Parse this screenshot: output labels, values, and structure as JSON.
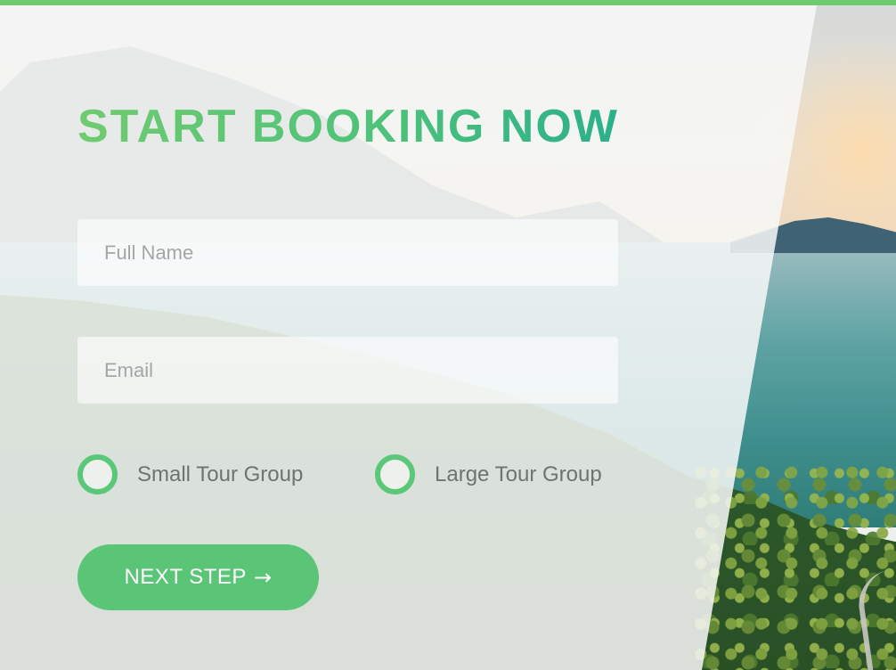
{
  "theme": {
    "accent": "#5ac576",
    "top_bar": "#6fcb6f",
    "title_gradient_start": "#6fcb6f",
    "title_gradient_end": "#2bb08a",
    "radio_border": "#5ac878"
  },
  "booking_form": {
    "title": "START BOOKING NOW",
    "full_name": {
      "placeholder": "Full Name",
      "value": ""
    },
    "email": {
      "placeholder": "Email",
      "value": ""
    },
    "tour_group_options": [
      {
        "label": "Small Tour Group",
        "selected": false
      },
      {
        "label": "Large Tour Group",
        "selected": false
      }
    ],
    "next_button": {
      "label": "NEXT STEP",
      "icon": "arrow-right-icon",
      "glyph": "→"
    }
  },
  "background": {
    "image": "mountain-lake-forest-landscape"
  }
}
